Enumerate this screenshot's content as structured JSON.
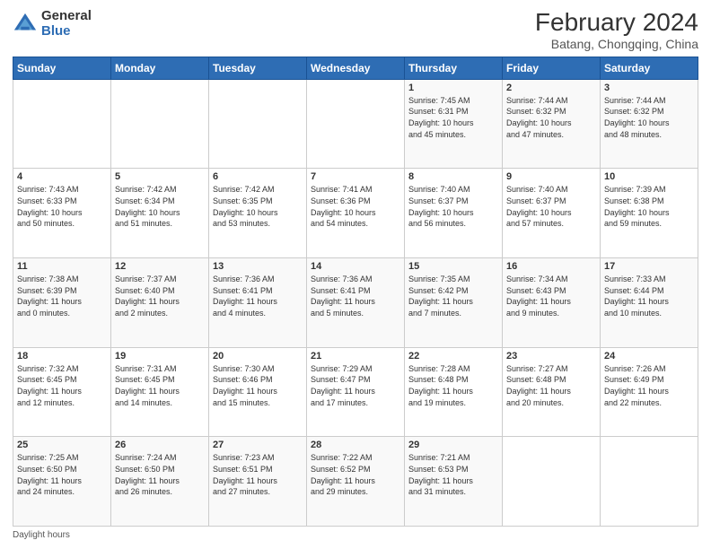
{
  "logo": {
    "general": "General",
    "blue": "Blue"
  },
  "header": {
    "title": "February 2024",
    "subtitle": "Batang, Chongqing, China"
  },
  "days_of_week": [
    "Sunday",
    "Monday",
    "Tuesday",
    "Wednesday",
    "Thursday",
    "Friday",
    "Saturday"
  ],
  "footer": {
    "daylight_hours": "Daylight hours"
  },
  "weeks": [
    [
      {
        "day": "",
        "info": ""
      },
      {
        "day": "",
        "info": ""
      },
      {
        "day": "",
        "info": ""
      },
      {
        "day": "",
        "info": ""
      },
      {
        "day": "1",
        "info": "Sunrise: 7:45 AM\nSunset: 6:31 PM\nDaylight: 10 hours\nand 45 minutes."
      },
      {
        "day": "2",
        "info": "Sunrise: 7:44 AM\nSunset: 6:32 PM\nDaylight: 10 hours\nand 47 minutes."
      },
      {
        "day": "3",
        "info": "Sunrise: 7:44 AM\nSunset: 6:32 PM\nDaylight: 10 hours\nand 48 minutes."
      }
    ],
    [
      {
        "day": "4",
        "info": "Sunrise: 7:43 AM\nSunset: 6:33 PM\nDaylight: 10 hours\nand 50 minutes."
      },
      {
        "day": "5",
        "info": "Sunrise: 7:42 AM\nSunset: 6:34 PM\nDaylight: 10 hours\nand 51 minutes."
      },
      {
        "day": "6",
        "info": "Sunrise: 7:42 AM\nSunset: 6:35 PM\nDaylight: 10 hours\nand 53 minutes."
      },
      {
        "day": "7",
        "info": "Sunrise: 7:41 AM\nSunset: 6:36 PM\nDaylight: 10 hours\nand 54 minutes."
      },
      {
        "day": "8",
        "info": "Sunrise: 7:40 AM\nSunset: 6:37 PM\nDaylight: 10 hours\nand 56 minutes."
      },
      {
        "day": "9",
        "info": "Sunrise: 7:40 AM\nSunset: 6:37 PM\nDaylight: 10 hours\nand 57 minutes."
      },
      {
        "day": "10",
        "info": "Sunrise: 7:39 AM\nSunset: 6:38 PM\nDaylight: 10 hours\nand 59 minutes."
      }
    ],
    [
      {
        "day": "11",
        "info": "Sunrise: 7:38 AM\nSunset: 6:39 PM\nDaylight: 11 hours\nand 0 minutes."
      },
      {
        "day": "12",
        "info": "Sunrise: 7:37 AM\nSunset: 6:40 PM\nDaylight: 11 hours\nand 2 minutes."
      },
      {
        "day": "13",
        "info": "Sunrise: 7:36 AM\nSunset: 6:41 PM\nDaylight: 11 hours\nand 4 minutes."
      },
      {
        "day": "14",
        "info": "Sunrise: 7:36 AM\nSunset: 6:41 PM\nDaylight: 11 hours\nand 5 minutes."
      },
      {
        "day": "15",
        "info": "Sunrise: 7:35 AM\nSunset: 6:42 PM\nDaylight: 11 hours\nand 7 minutes."
      },
      {
        "day": "16",
        "info": "Sunrise: 7:34 AM\nSunset: 6:43 PM\nDaylight: 11 hours\nand 9 minutes."
      },
      {
        "day": "17",
        "info": "Sunrise: 7:33 AM\nSunset: 6:44 PM\nDaylight: 11 hours\nand 10 minutes."
      }
    ],
    [
      {
        "day": "18",
        "info": "Sunrise: 7:32 AM\nSunset: 6:45 PM\nDaylight: 11 hours\nand 12 minutes."
      },
      {
        "day": "19",
        "info": "Sunrise: 7:31 AM\nSunset: 6:45 PM\nDaylight: 11 hours\nand 14 minutes."
      },
      {
        "day": "20",
        "info": "Sunrise: 7:30 AM\nSunset: 6:46 PM\nDaylight: 11 hours\nand 15 minutes."
      },
      {
        "day": "21",
        "info": "Sunrise: 7:29 AM\nSunset: 6:47 PM\nDaylight: 11 hours\nand 17 minutes."
      },
      {
        "day": "22",
        "info": "Sunrise: 7:28 AM\nSunset: 6:48 PM\nDaylight: 11 hours\nand 19 minutes."
      },
      {
        "day": "23",
        "info": "Sunrise: 7:27 AM\nSunset: 6:48 PM\nDaylight: 11 hours\nand 20 minutes."
      },
      {
        "day": "24",
        "info": "Sunrise: 7:26 AM\nSunset: 6:49 PM\nDaylight: 11 hours\nand 22 minutes."
      }
    ],
    [
      {
        "day": "25",
        "info": "Sunrise: 7:25 AM\nSunset: 6:50 PM\nDaylight: 11 hours\nand 24 minutes."
      },
      {
        "day": "26",
        "info": "Sunrise: 7:24 AM\nSunset: 6:50 PM\nDaylight: 11 hours\nand 26 minutes."
      },
      {
        "day": "27",
        "info": "Sunrise: 7:23 AM\nSunset: 6:51 PM\nDaylight: 11 hours\nand 27 minutes."
      },
      {
        "day": "28",
        "info": "Sunrise: 7:22 AM\nSunset: 6:52 PM\nDaylight: 11 hours\nand 29 minutes."
      },
      {
        "day": "29",
        "info": "Sunrise: 7:21 AM\nSunset: 6:53 PM\nDaylight: 11 hours\nand 31 minutes."
      },
      {
        "day": "",
        "info": ""
      },
      {
        "day": "",
        "info": ""
      }
    ]
  ]
}
